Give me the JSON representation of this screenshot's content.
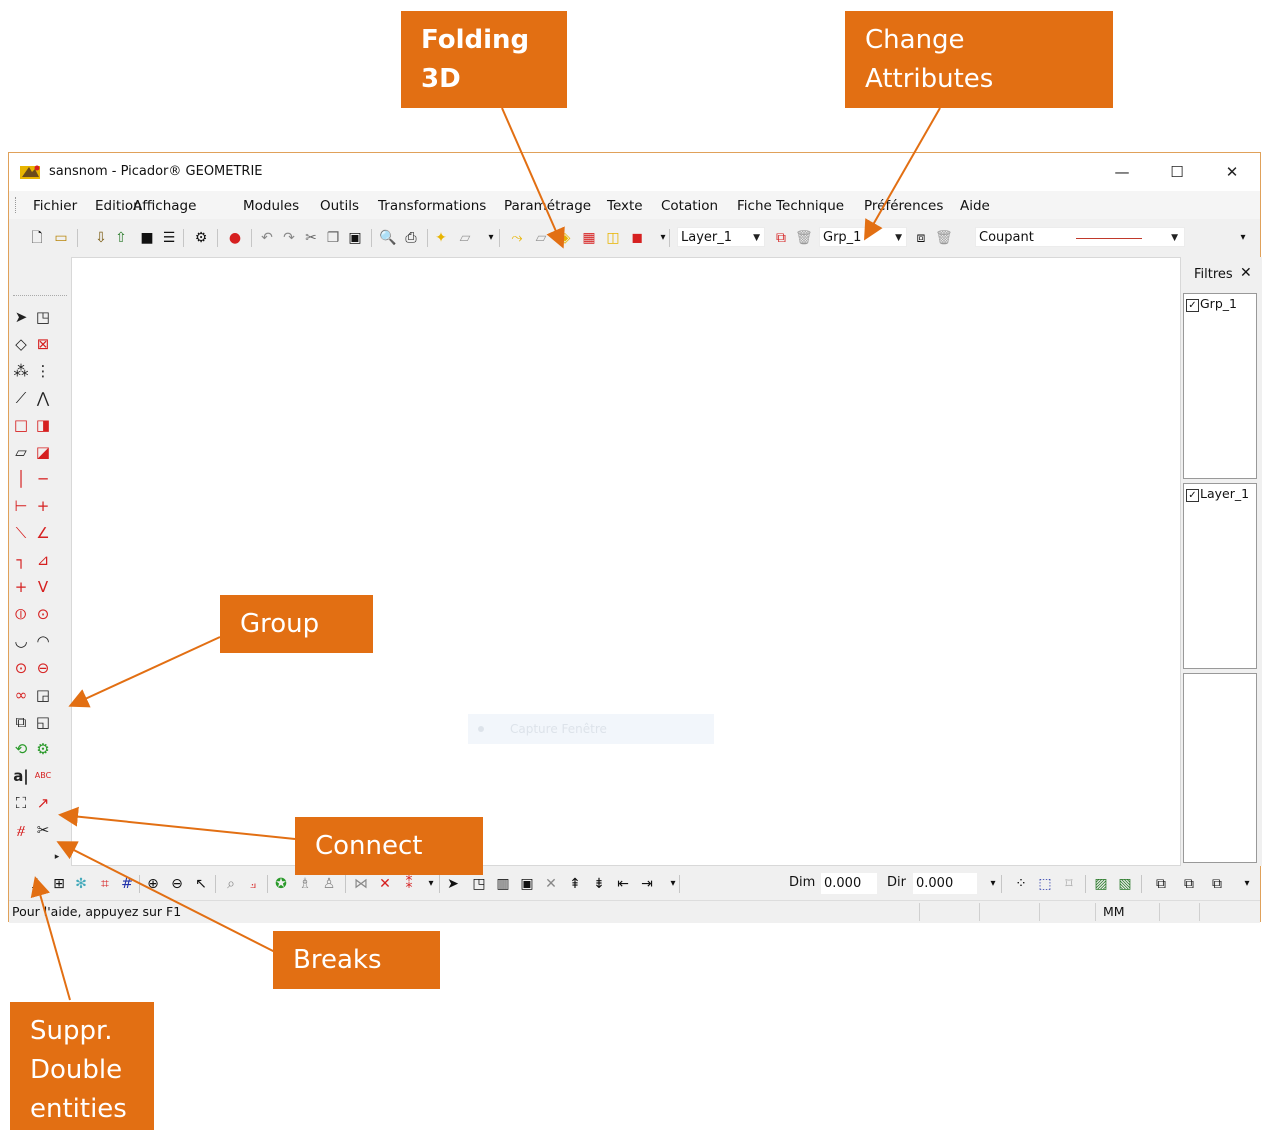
{
  "window": {
    "title": "sansnom - Picador® GEOMETRIE",
    "controls": {
      "minimize": "—",
      "maximize": "☐",
      "close": "✕"
    }
  },
  "menu": [
    "Fichier",
    "Edition",
    "Affichage",
    "Modules",
    "Outils",
    "Transformations",
    "Paramétrage",
    "Texte",
    "Cotation",
    "Fiche Technique",
    "Préférences",
    "Aide"
  ],
  "toolbar": {
    "layer_combo": "Layer_1",
    "group_combo": "Grp_1",
    "line_type_combo": "Coupant",
    "line_color": "#c0392b"
  },
  "canvas": {
    "ghost_label": "Capture Fenêtre"
  },
  "filters": {
    "title": "Filtres",
    "close": "✕",
    "groups": [
      {
        "label": "Grp_1",
        "checked": true
      }
    ],
    "layers": [
      {
        "label": "Layer_1",
        "checked": true
      }
    ]
  },
  "bottom_toolbar": {
    "dim_label": "Dim",
    "dim_value": "0.000",
    "dir_label": "Dir",
    "dir_value": "0.000"
  },
  "status": {
    "help_text": "Pour l'aide, appuyez sur F1",
    "units": "MM"
  },
  "callouts": {
    "folding": "Folding\n3D",
    "change_attributes": "Change\nAttributes",
    "group": "Group",
    "connect": "Connect",
    "breaks": "Breaks",
    "suppr": "Suppr.\nDouble\nentities"
  },
  "colors": {
    "callout": "#e26f13",
    "accent_red": "#d62020",
    "icon_yellow": "#e8b400"
  }
}
